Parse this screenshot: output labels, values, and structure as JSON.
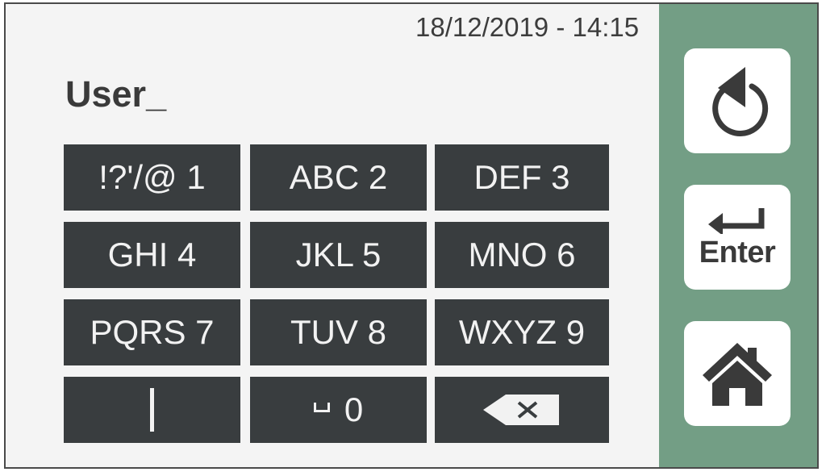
{
  "status": {
    "datetime": "18/12/2019 - 14:15"
  },
  "input": {
    "value": "User_"
  },
  "keypad": {
    "keys": [
      {
        "label": "!?'/@ 1",
        "name": "key-1"
      },
      {
        "label": "ABC 2",
        "name": "key-2"
      },
      {
        "label": "DEF 3",
        "name": "key-3"
      },
      {
        "label": "GHI 4",
        "name": "key-4"
      },
      {
        "label": "JKL 5",
        "name": "key-5"
      },
      {
        "label": "MNO 6",
        "name": "key-6"
      },
      {
        "label": "PQRS 7",
        "name": "key-7"
      },
      {
        "label": "TUV 8",
        "name": "key-8"
      },
      {
        "label": "WXYZ 9",
        "name": "key-9"
      }
    ],
    "zero_label": "0",
    "cursor_key_icon": "text-cursor-icon",
    "space_icon": "space-icon",
    "backspace_icon": "backspace-icon"
  },
  "side_panel": {
    "back_icon": "undo-arrow-icon",
    "enter_icon": "enter-arrow-icon",
    "enter_label": "Enter",
    "home_icon": "home-icon"
  },
  "colors": {
    "key_background": "#393d3f",
    "key_text": "#f2f2f2",
    "side_panel": "#739e85",
    "screen_background": "#f4f4f4"
  }
}
